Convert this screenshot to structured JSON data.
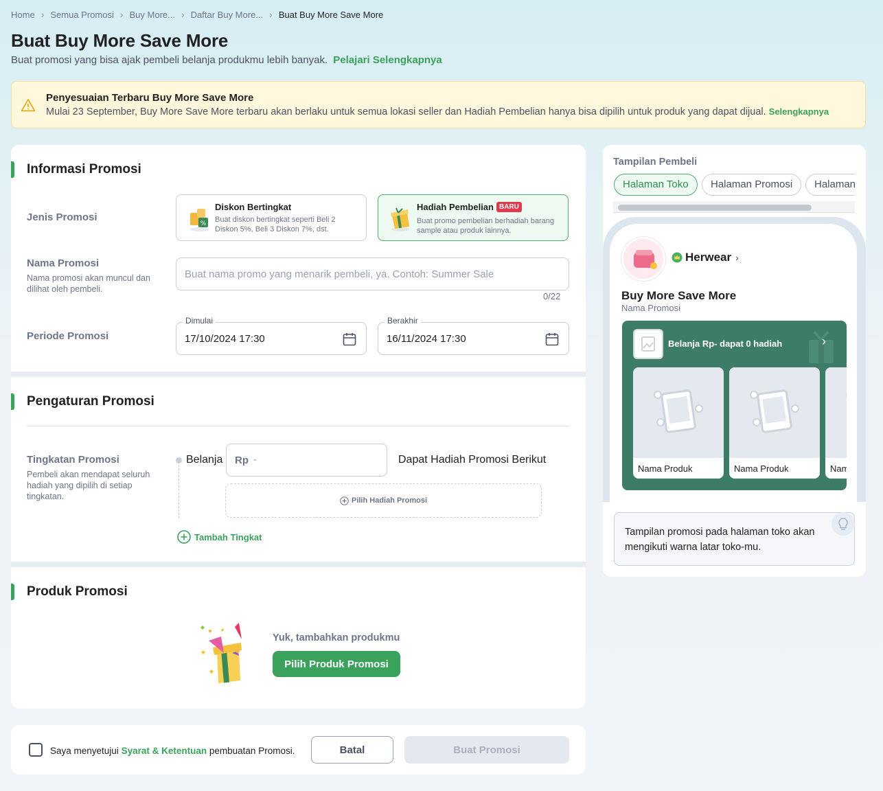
{
  "breadcrumb": [
    "Home",
    "Semua Promosi",
    "Buy More...",
    "Daftar Buy More...",
    "Buat Buy More Save More"
  ],
  "page": {
    "title": "Buat Buy More Save More",
    "subtitle": "Buat promosi yang bisa ajak pembeli belanja produkmu lebih banyak.",
    "subtitle_link": "Pelajari Selengkapnya"
  },
  "alert": {
    "title": "Penyesuaian Terbaru Buy More Save More",
    "message": "Mulai 23 September, Buy More Save More terbaru akan berlaku untuk semua lokasi seller dan Hadiah Pembelian hanya bisa dipilih untuk produk yang dapat dijual.",
    "link": "Selengkapnya"
  },
  "info": {
    "section_title": "Informasi Promosi",
    "type_label": "Jenis Promosi",
    "type_options": [
      {
        "title": "Diskon Bertingkat",
        "desc": "Buat diskon bertingkat seperti Beli 2 Diskon 5%, Beli 3 Diskon 7%, dst.",
        "selected": false
      },
      {
        "title": "Hadiah Pembelian",
        "badge": "BARU",
        "desc": "Buat promo pembelian berhadiah barang sample atau produk lainnya.",
        "selected": true
      }
    ],
    "name_label": "Nama Promosi",
    "name_help": "Nama promosi akan muncul dan dilihat oleh pembeli.",
    "name_placeholder": "Buat nama promo yang menarik pembeli, ya. Contoh: Summer Sale",
    "name_counter": "0/22",
    "period_label": "Periode Promosi",
    "start_label": "Dimulai",
    "start_value": "17/10/2024 17:30",
    "end_label": "Berakhir",
    "end_value": "16/11/2024 17:30"
  },
  "settings": {
    "section_title": "Pengaturan Promosi",
    "tier_label": "Tingkatan Promosi",
    "tier_help": "Pembeli akan mendapat seluruh hadiah yang dipilih di setiap tingkatan.",
    "spend_label": "Belanja",
    "currency": "Rp",
    "amount_placeholder": "-",
    "reward_text": "Dapat Hadiah Promosi Berikut",
    "pick_reward": "Pilih Hadiah Promosi",
    "add_tier": "Tambah Tingkat"
  },
  "products": {
    "section_title": "Produk Promosi",
    "empty_text": "Yuk, tambahkan produkmu",
    "button": "Pilih Produk Promosi"
  },
  "footer": {
    "agree_prefix": "Saya menyetujui",
    "agree_link": "Syarat & Ketentuan",
    "agree_suffix": "pembuatan Promosi.",
    "cancel": "Batal",
    "submit": "Buat Promosi"
  },
  "preview": {
    "title": "Tampilan Pembeli",
    "tabs": [
      "Halaman Toko",
      "Halaman Promosi",
      "Halaman"
    ],
    "shop_name": "Herwear",
    "promo_title": "Buy More Save More",
    "promo_sub": "Nama Promosi",
    "tier_text": "Belanja Rp- dapat 0 hadiah",
    "product_names": [
      "Nama Produk",
      "Nama Produk",
      "Nama Produk"
    ],
    "note": "Tampilan promosi pada halaman toko akan mengikuti warna latar toko-mu."
  },
  "colors": {
    "accent": "#3aa25a",
    "alert_bg": "#fff8dc",
    "promo_box": "#3d7c66",
    "badge": "#e0394b"
  }
}
